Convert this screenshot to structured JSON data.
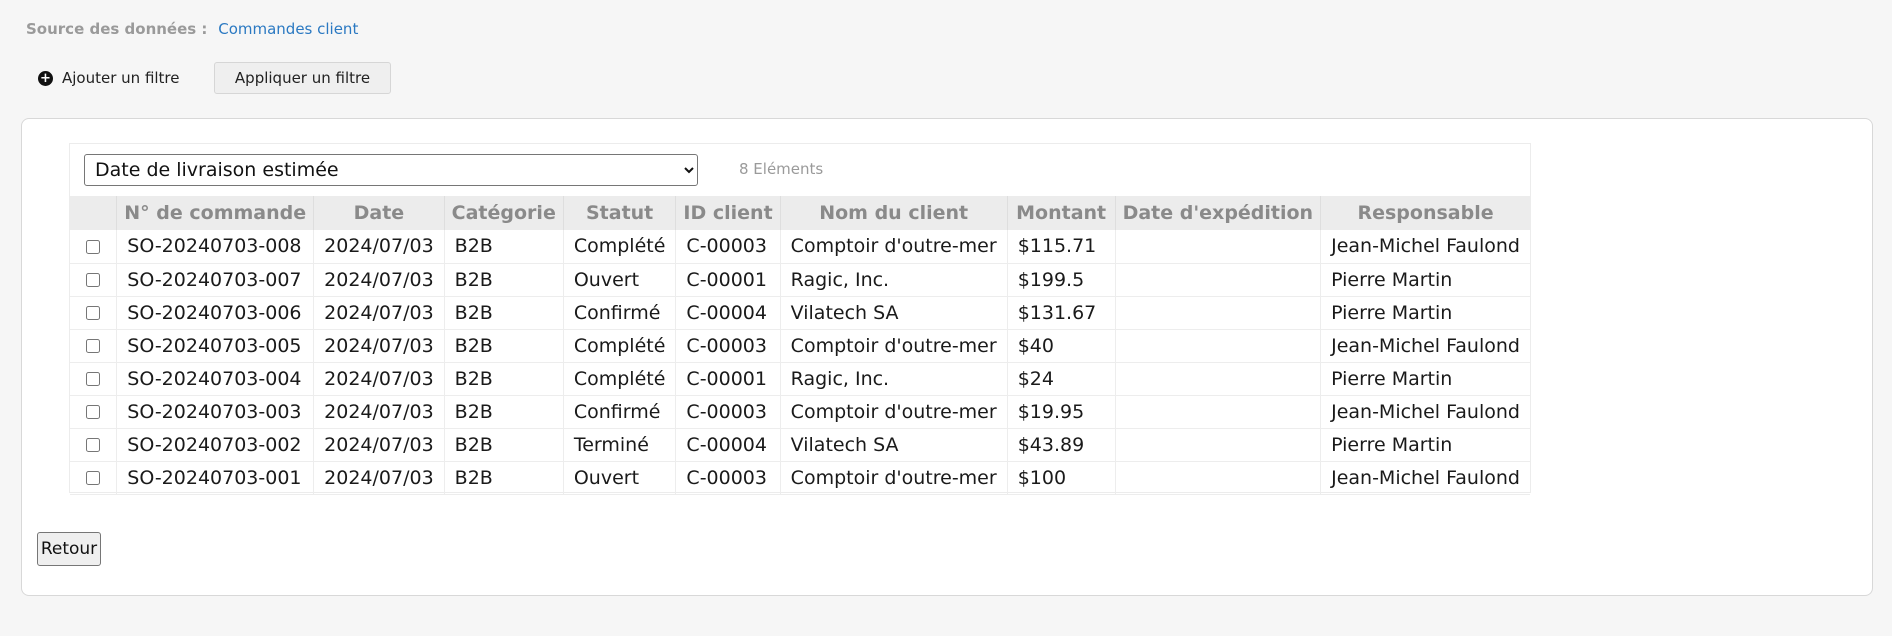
{
  "source": {
    "label": "Source des données :",
    "link": "Commandes client"
  },
  "filters": {
    "add_label": "Ajouter un filtre",
    "apply_label": "Appliquer un filtre",
    "add_icon": "plus-circle-icon"
  },
  "list": {
    "field_selected": "Date de livraison estimée",
    "item_count": "8 Eléments",
    "columns": [
      "N° de commande",
      "Date",
      "Catégorie",
      "Statut",
      "ID client",
      "Nom du client",
      "Montant",
      "Date d'expédition",
      "Responsable"
    ],
    "rows": [
      [
        "SO-20240703-008",
        "2024/07/03",
        "B2B",
        "Complété",
        "C-00003",
        "Comptoir d'outre-mer",
        "$115.71",
        "",
        "Jean-Michel Faulond"
      ],
      [
        "SO-20240703-007",
        "2024/07/03",
        "B2B",
        "Ouvert",
        "C-00001",
        "Ragic, Inc.",
        "$199.5",
        "",
        "Pierre Martin"
      ],
      [
        "SO-20240703-006",
        "2024/07/03",
        "B2B",
        "Confirmé",
        "C-00004",
        "Vilatech SA",
        "$131.67",
        "",
        "Pierre Martin"
      ],
      [
        "SO-20240703-005",
        "2024/07/03",
        "B2B",
        "Complété",
        "C-00003",
        "Comptoir d'outre-mer",
        "$40",
        "",
        "Jean-Michel Faulond"
      ],
      [
        "SO-20240703-004",
        "2024/07/03",
        "B2B",
        "Complété",
        "C-00001",
        "Ragic, Inc.",
        "$24",
        "",
        "Pierre Martin"
      ],
      [
        "SO-20240703-003",
        "2024/07/03",
        "B2B",
        "Confirmé",
        "C-00003",
        "Comptoir d'outre-mer",
        "$19.95",
        "",
        "Jean-Michel Faulond"
      ],
      [
        "SO-20240703-002",
        "2024/07/03",
        "B2B",
        "Terminé",
        "C-00004",
        "Vilatech SA",
        "$43.89",
        "",
        "Pierre Martin"
      ],
      [
        "SO-20240703-001",
        "2024/07/03",
        "B2B",
        "Ouvert",
        "C-00003",
        "Comptoir d'outre-mer",
        "$100",
        "",
        "Jean-Michel Faulond"
      ]
    ]
  },
  "back_label": "Retour"
}
